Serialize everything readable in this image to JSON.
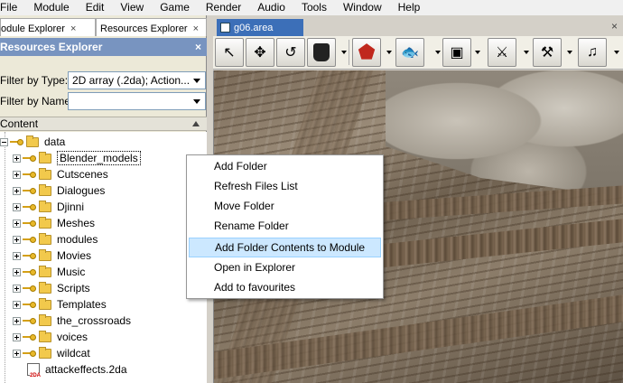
{
  "menubar": {
    "items": [
      "File",
      "Module",
      "Edit",
      "View",
      "Game",
      "Render",
      "Audio",
      "Tools",
      "Window",
      "Help"
    ]
  },
  "left_panel": {
    "tabs": [
      {
        "label": "odule Explorer",
        "close": "×"
      },
      {
        "label": "Resources Explorer",
        "close": "×"
      }
    ],
    "title": "Resources Explorer",
    "title_close": "×",
    "filter_type": {
      "label": "Filter by Type:",
      "value": "2D array (.2da); Action..."
    },
    "filter_name": {
      "label": "Filter by Name:",
      "value": ""
    },
    "content_header": "Content",
    "tree": {
      "root": "data",
      "folders": [
        "Blender_models",
        "Cutscenes",
        "Dialogues",
        "Djinni",
        "Meshes",
        "modules",
        "Movies",
        "Music",
        "Scripts",
        "Templates",
        "the_crossroads",
        "voices",
        "wildcat"
      ],
      "files": [
        {
          "name": "attackeffects.2da",
          "tag": "2DA"
        }
      ]
    }
  },
  "document": {
    "tab_label": "g06.area",
    "close": "×",
    "toolbar_icons": [
      "select-icon",
      "move-icon",
      "rotate-icon",
      "bucket-icon",
      "pentagon-icon",
      "fish-icon",
      "crate-icon",
      "sword-icon",
      "axe-icon",
      "music-note-icon"
    ]
  },
  "context_menu": {
    "items": [
      "Add Folder",
      "Refresh Files List",
      "Move Folder",
      "Rename Folder",
      "Add Folder Contents to Module",
      "Open in Explorer",
      "Add to favourites"
    ],
    "highlighted_index": 4
  },
  "colors": {
    "panel_title_bg": "#7894c0",
    "doc_tab_bg": "#3c6fb8",
    "menu_highlight": "#cce8ff"
  }
}
